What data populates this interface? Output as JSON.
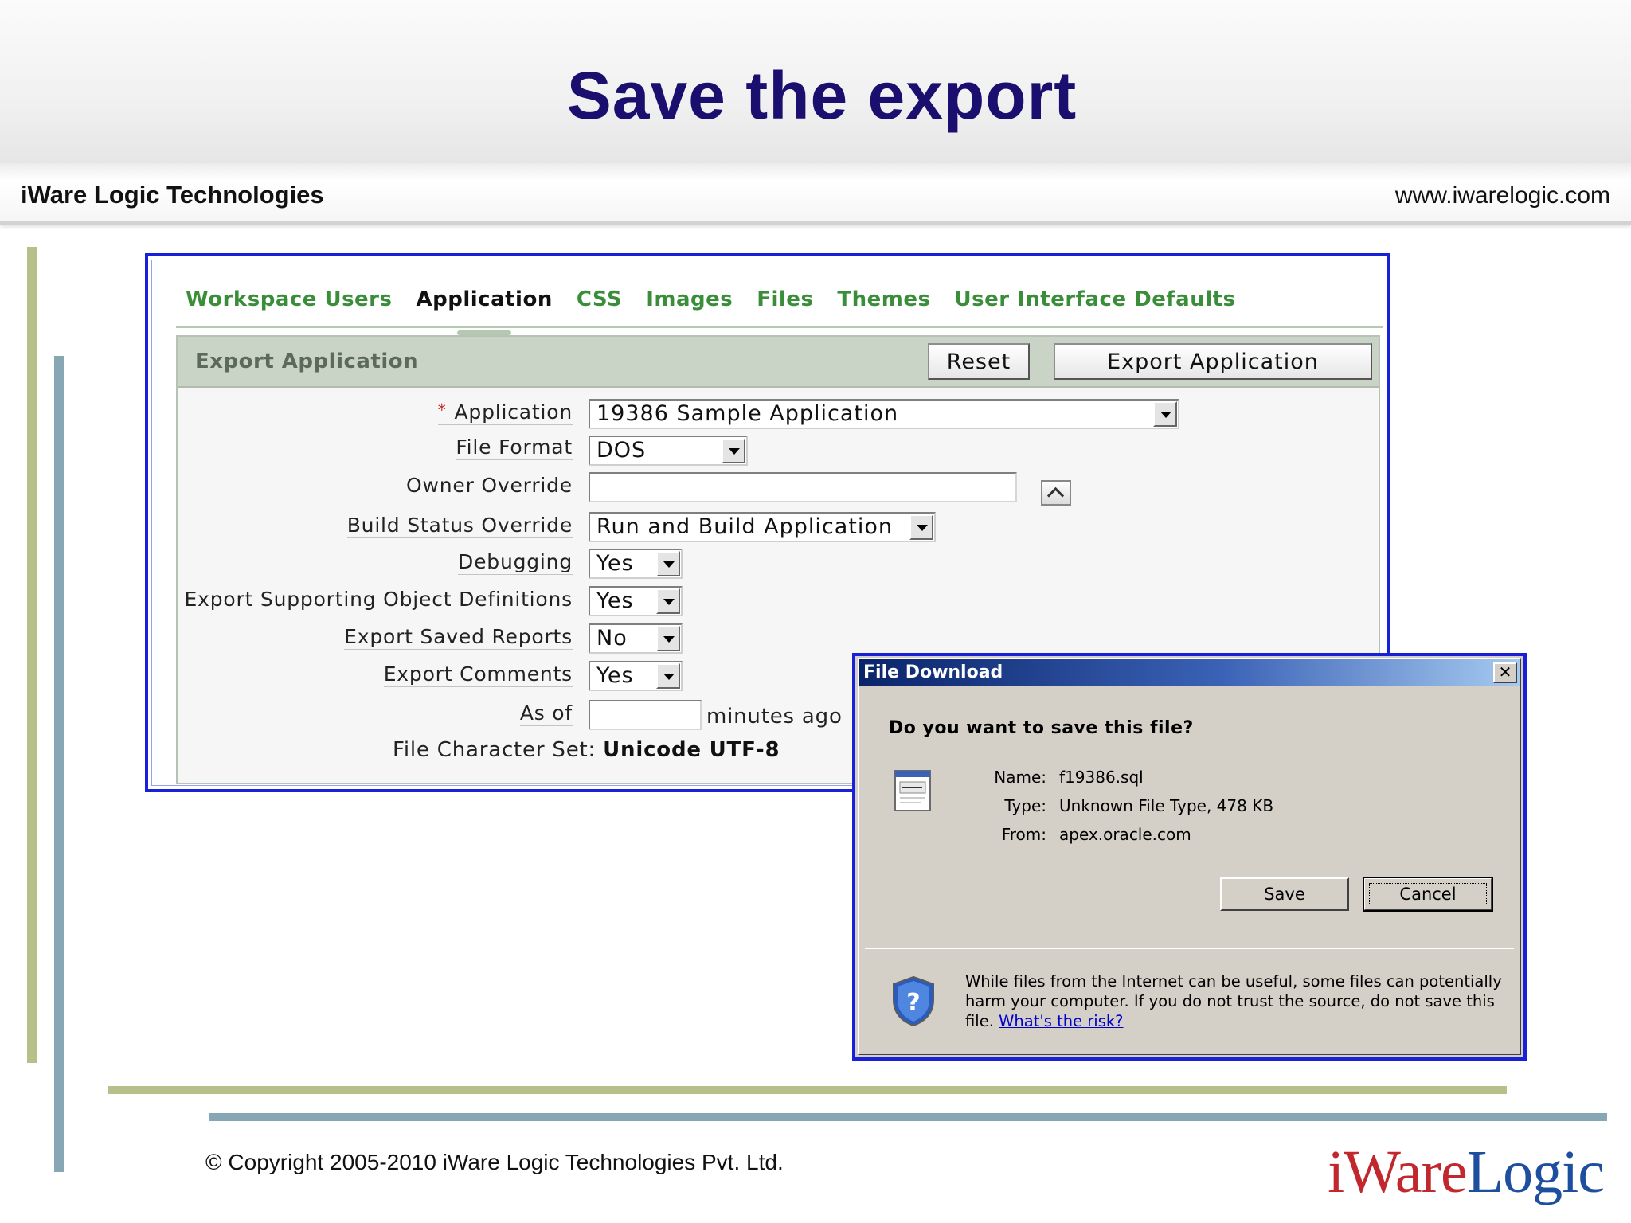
{
  "slide": {
    "title": "Save the export",
    "company": "iWare Logic Technologies",
    "website": "www.iwarelogic.com",
    "copyright": "© Copyright 2005-2010 iWare Logic Technologies Pvt. Ltd.",
    "logo": {
      "part1": "iWare",
      "part2": "Logic"
    }
  },
  "apex": {
    "tabs": [
      {
        "label": "Workspace Users",
        "active": false
      },
      {
        "label": "Application",
        "active": true
      },
      {
        "label": "CSS",
        "active": false
      },
      {
        "label": "Images",
        "active": false
      },
      {
        "label": "Files",
        "active": false
      },
      {
        "label": "Themes",
        "active": false
      },
      {
        "label": "User Interface Defaults",
        "active": false
      }
    ],
    "region_title": "Export Application",
    "buttons": {
      "reset": "Reset",
      "export": "Export Application"
    },
    "required_marker": "*",
    "fields": {
      "application": {
        "label": "Application",
        "value": "19386 Sample Application"
      },
      "file_format": {
        "label": "File Format",
        "value": "DOS"
      },
      "owner_override": {
        "label": "Owner Override",
        "value": ""
      },
      "build_status": {
        "label": "Build Status Override",
        "value": "Run and Build Application"
      },
      "debugging": {
        "label": "Debugging",
        "value": "Yes"
      },
      "supporting_objects": {
        "label": "Export Supporting Object Definitions",
        "value": "Yes"
      },
      "saved_reports": {
        "label": "Export Saved Reports",
        "value": "No"
      },
      "comments": {
        "label": "Export Comments",
        "value": "Yes"
      },
      "as_of": {
        "label": "As of",
        "value": "",
        "suffix": "minutes ago"
      },
      "charset": {
        "label": "File Character Set:",
        "value": "Unicode UTF-8"
      }
    }
  },
  "dialog": {
    "title": "File Download",
    "close_glyph": "✕",
    "question": "Do you want to save this file?",
    "name_label": "Name:",
    "name_value": "f19386.sql",
    "type_label": "Type:",
    "type_value": "Unknown File Type, 478 KB",
    "from_label": "From:",
    "from_value": "apex.oracle.com",
    "save_label": "Save",
    "cancel_label": "Cancel",
    "warning": "While files from the Internet can be useful, some files can potentially harm your computer. If you do not trust the source, do not save this file.",
    "link": "What's the risk?",
    "icons": {
      "file": "file-icon",
      "shield": "shield-question-icon"
    }
  },
  "colors": {
    "title": "#1a0f6e",
    "tab_green": "#3a8e3a",
    "frame_blue": "#1820d8",
    "dialog_title": "#0a246a",
    "logo_red": "#c0282d",
    "logo_blue": "#1d4f9e"
  }
}
